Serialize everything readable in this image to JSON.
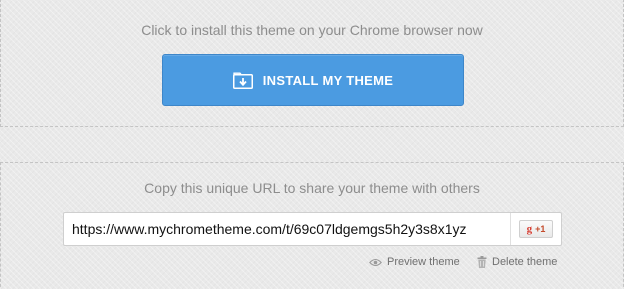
{
  "install_section": {
    "heading": "Click to install this theme on your Chrome browser now",
    "button_label": "INSTALL MY THEME",
    "button_icon": "folder-download-icon"
  },
  "share_section": {
    "heading": "Copy this unique URL to share your theme with others",
    "url_value": "https://www.mychrometheme.com/t/69c07ldgemgs5h2y3s8x1yz",
    "gplus": {
      "g": "g",
      "count": "+1"
    },
    "actions": {
      "preview_label": "Preview theme",
      "delete_label": "Delete theme"
    }
  },
  "colors": {
    "button_bg": "#4b9be1",
    "page_bg": "#e9e9e9",
    "heading_text": "#8d8d8d"
  }
}
